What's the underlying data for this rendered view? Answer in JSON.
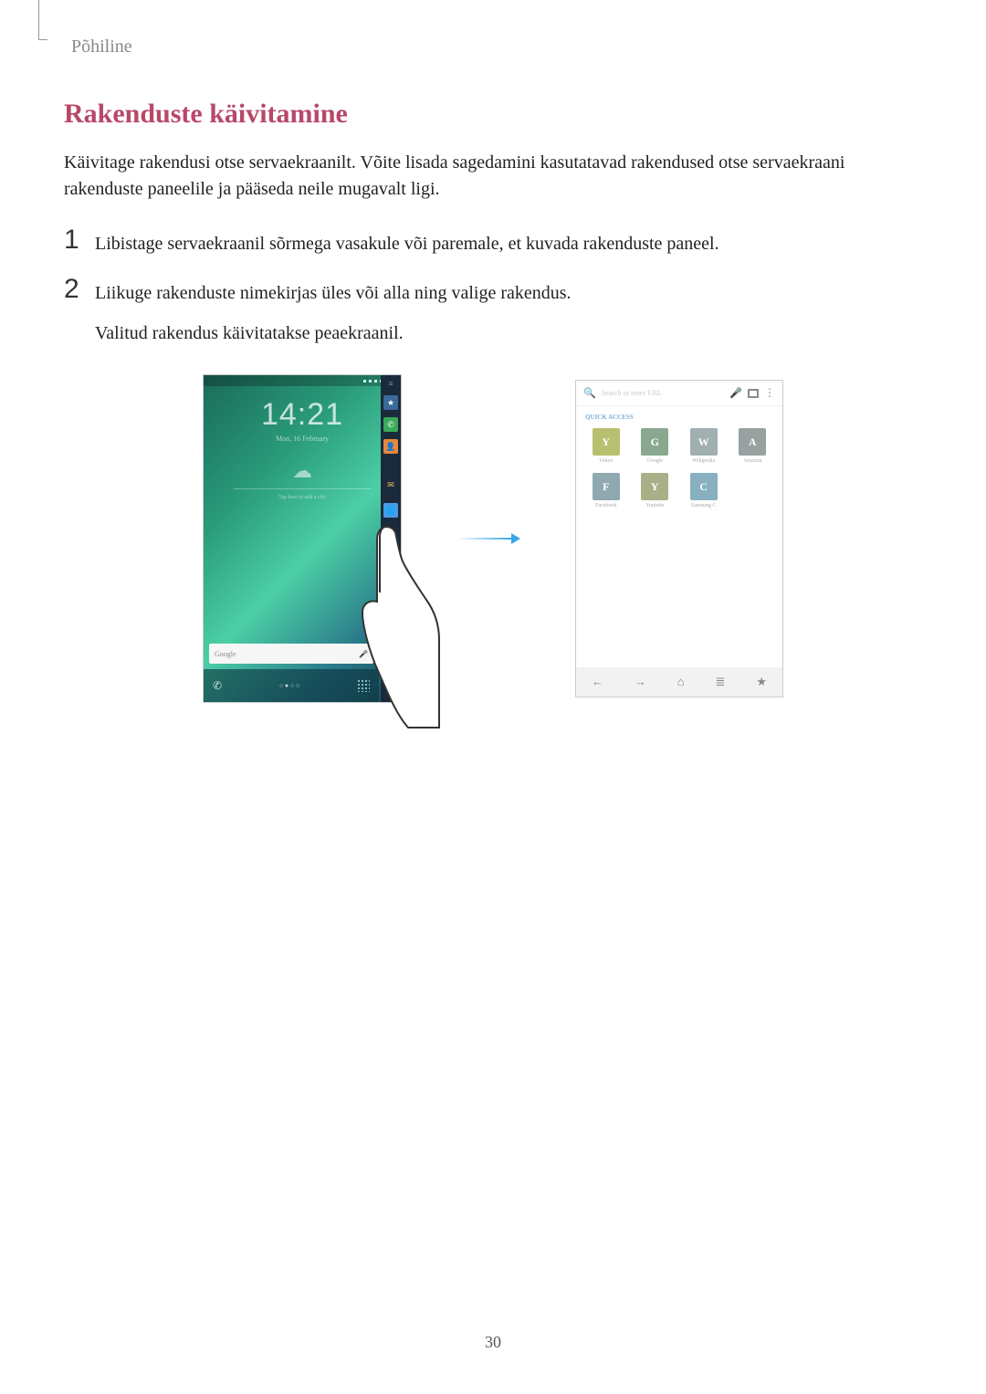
{
  "header": {
    "section": "Põhiline"
  },
  "title": "Rakenduste käivitamine",
  "intro": "Käivitage rakendusi otse servaekraanilt. Võite lisada sagedamini kasutatavad rakendused otse servaekraani rakenduste paneelile ja pääseda neile mugavalt ligi.",
  "steps": [
    {
      "num": "1",
      "text": "Libistage servaekraanil sõrmega vasakule või paremale, et kuvada rakenduste paneel.",
      "sub": ""
    },
    {
      "num": "2",
      "text": "Liikuge rakenduste nimekirjas üles või alla ning valige rakendus.",
      "sub": "Valitud rakendus käivitatakse peaekraanil."
    }
  ],
  "figure": {
    "left": {
      "clock": "14:21",
      "date": "Mon, 16 February",
      "search_label": "Google",
      "edge_items": [
        "menu",
        "star",
        "phone",
        "person",
        "mail",
        "globe",
        "pencil",
        "red",
        "chev"
      ]
    },
    "arrow": "→",
    "right": {
      "search_placeholder": "Search or enter URL",
      "subtitle": "QUICK ACCESS",
      "tiles": [
        {
          "letter": "Y",
          "label": "Yahoo",
          "cls": "Y"
        },
        {
          "letter": "G",
          "label": "Google",
          "cls": "G"
        },
        {
          "letter": "W",
          "label": "Wikipedia",
          "cls": "W"
        },
        {
          "letter": "A",
          "label": "Amazon",
          "cls": "A"
        },
        {
          "letter": "F",
          "label": "Facebook",
          "cls": "F"
        },
        {
          "letter": "Y",
          "label": "Youtube",
          "cls": "Y2"
        },
        {
          "letter": "C",
          "label": "Samsung C",
          "cls": "C"
        }
      ],
      "nav": [
        "←",
        "→",
        "⌂",
        "≣",
        "★"
      ]
    }
  },
  "page_number": "30"
}
